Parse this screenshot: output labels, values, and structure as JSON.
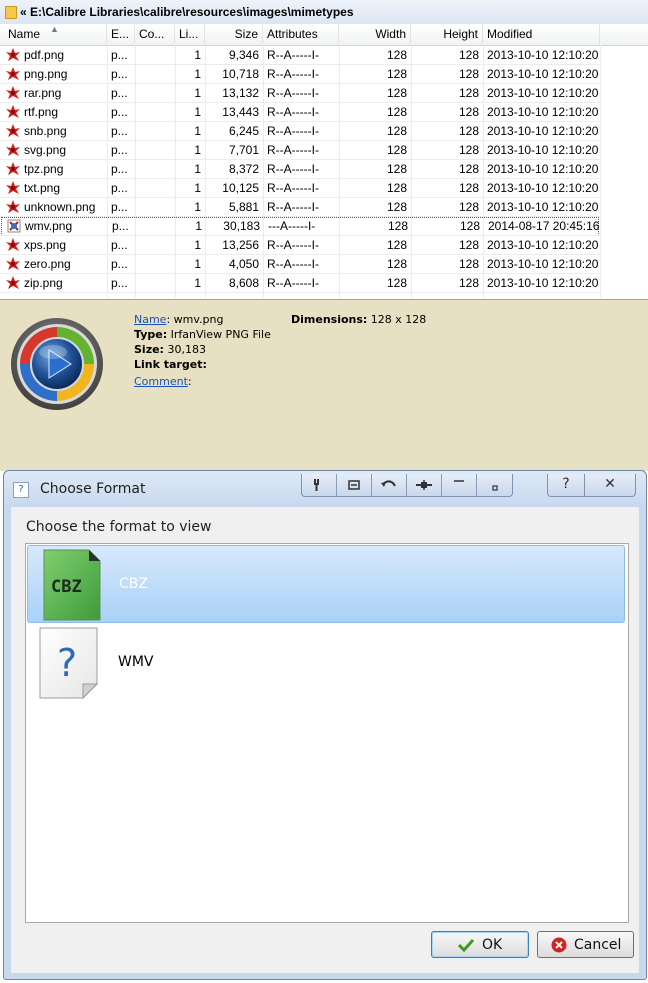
{
  "path": "« E:\\Calibre Libraries\\calibre\\resources\\images\\mimetypes",
  "columns": [
    "Name",
    "E...",
    "Co...",
    "Li...",
    "Size",
    "Attributes",
    "Width",
    "Height",
    "Modified"
  ],
  "files": [
    {
      "name": "pdf.png",
      "ext": "p...",
      "links": "1",
      "size": "9,346",
      "attr": "R--A-----I-",
      "width": "128",
      "height": "128",
      "modified": "2013-10-10 12:10:20"
    },
    {
      "name": "png.png",
      "ext": "p...",
      "links": "1",
      "size": "10,718",
      "attr": "R--A-----I-",
      "width": "128",
      "height": "128",
      "modified": "2013-10-10 12:10:20"
    },
    {
      "name": "rar.png",
      "ext": "p...",
      "links": "1",
      "size": "13,132",
      "attr": "R--A-----I-",
      "width": "128",
      "height": "128",
      "modified": "2013-10-10 12:10:20"
    },
    {
      "name": "rtf.png",
      "ext": "p...",
      "links": "1",
      "size": "13,443",
      "attr": "R--A-----I-",
      "width": "128",
      "height": "128",
      "modified": "2013-10-10 12:10:20"
    },
    {
      "name": "snb.png",
      "ext": "p...",
      "links": "1",
      "size": "6,245",
      "attr": "R--A-----I-",
      "width": "128",
      "height": "128",
      "modified": "2013-10-10 12:10:20"
    },
    {
      "name": "svg.png",
      "ext": "p...",
      "links": "1",
      "size": "7,701",
      "attr": "R--A-----I-",
      "width": "128",
      "height": "128",
      "modified": "2013-10-10 12:10:20"
    },
    {
      "name": "tpz.png",
      "ext": "p...",
      "links": "1",
      "size": "8,372",
      "attr": "R--A-----I-",
      "width": "128",
      "height": "128",
      "modified": "2013-10-10 12:10:20"
    },
    {
      "name": "txt.png",
      "ext": "p...",
      "links": "1",
      "size": "10,125",
      "attr": "R--A-----I-",
      "width": "128",
      "height": "128",
      "modified": "2013-10-10 12:10:20"
    },
    {
      "name": "unknown.png",
      "ext": "p...",
      "links": "1",
      "size": "5,881",
      "attr": "R--A-----I-",
      "width": "128",
      "height": "128",
      "modified": "2013-10-10 12:10:20"
    },
    {
      "name": "wmv.png",
      "ext": "p...",
      "links": "1",
      "size": "30,183",
      "attr": "---A-----I-",
      "width": "128",
      "height": "128",
      "modified": "2014-08-17 20:45:16",
      "selected": true
    },
    {
      "name": "xps.png",
      "ext": "p...",
      "links": "1",
      "size": "13,256",
      "attr": "R--A-----I-",
      "width": "128",
      "height": "128",
      "modified": "2013-10-10 12:10:20"
    },
    {
      "name": "zero.png",
      "ext": "p...",
      "links": "1",
      "size": "4,050",
      "attr": "R--A-----I-",
      "width": "128",
      "height": "128",
      "modified": "2013-10-10 12:10:20"
    },
    {
      "name": "zip.png",
      "ext": "p...",
      "links": "1",
      "size": "8,608",
      "attr": "R--A-----I-",
      "width": "128",
      "height": "128",
      "modified": "2013-10-10 12:10:20"
    }
  ],
  "preview": {
    "name_label": "Name",
    "name_value": ": wmv.png",
    "dimensions_label": "Dimensions:",
    "dimensions_value": " 128 x 128",
    "type_label": "Type:",
    "type_value": " IrfanView PNG File",
    "size_label": "Size:",
    "size_value": " 30,183",
    "link_label": "Link target:",
    "comment_label": "Comment",
    "comment_value": ":"
  },
  "dialog": {
    "title": "Choose Format",
    "prompt": "Choose the format to view",
    "formats": [
      {
        "label": "CBZ",
        "icon": "cbz-file-icon",
        "icon_text": "CBZ",
        "selected": true
      },
      {
        "label": "WMV",
        "icon": "unknown-file-icon",
        "icon_text": "?",
        "selected": false
      }
    ],
    "ok_label": "OK",
    "cancel_label": "Cancel",
    "help_glyph": "?",
    "close_glyph": "✕"
  },
  "colors": {
    "preview_bg": "#e8e0c2",
    "selection_blue": "#a9d1f7",
    "link_blue": "#1b52b5",
    "ok_check_green": "#3a9d23",
    "cancel_red": "#d4231c"
  }
}
